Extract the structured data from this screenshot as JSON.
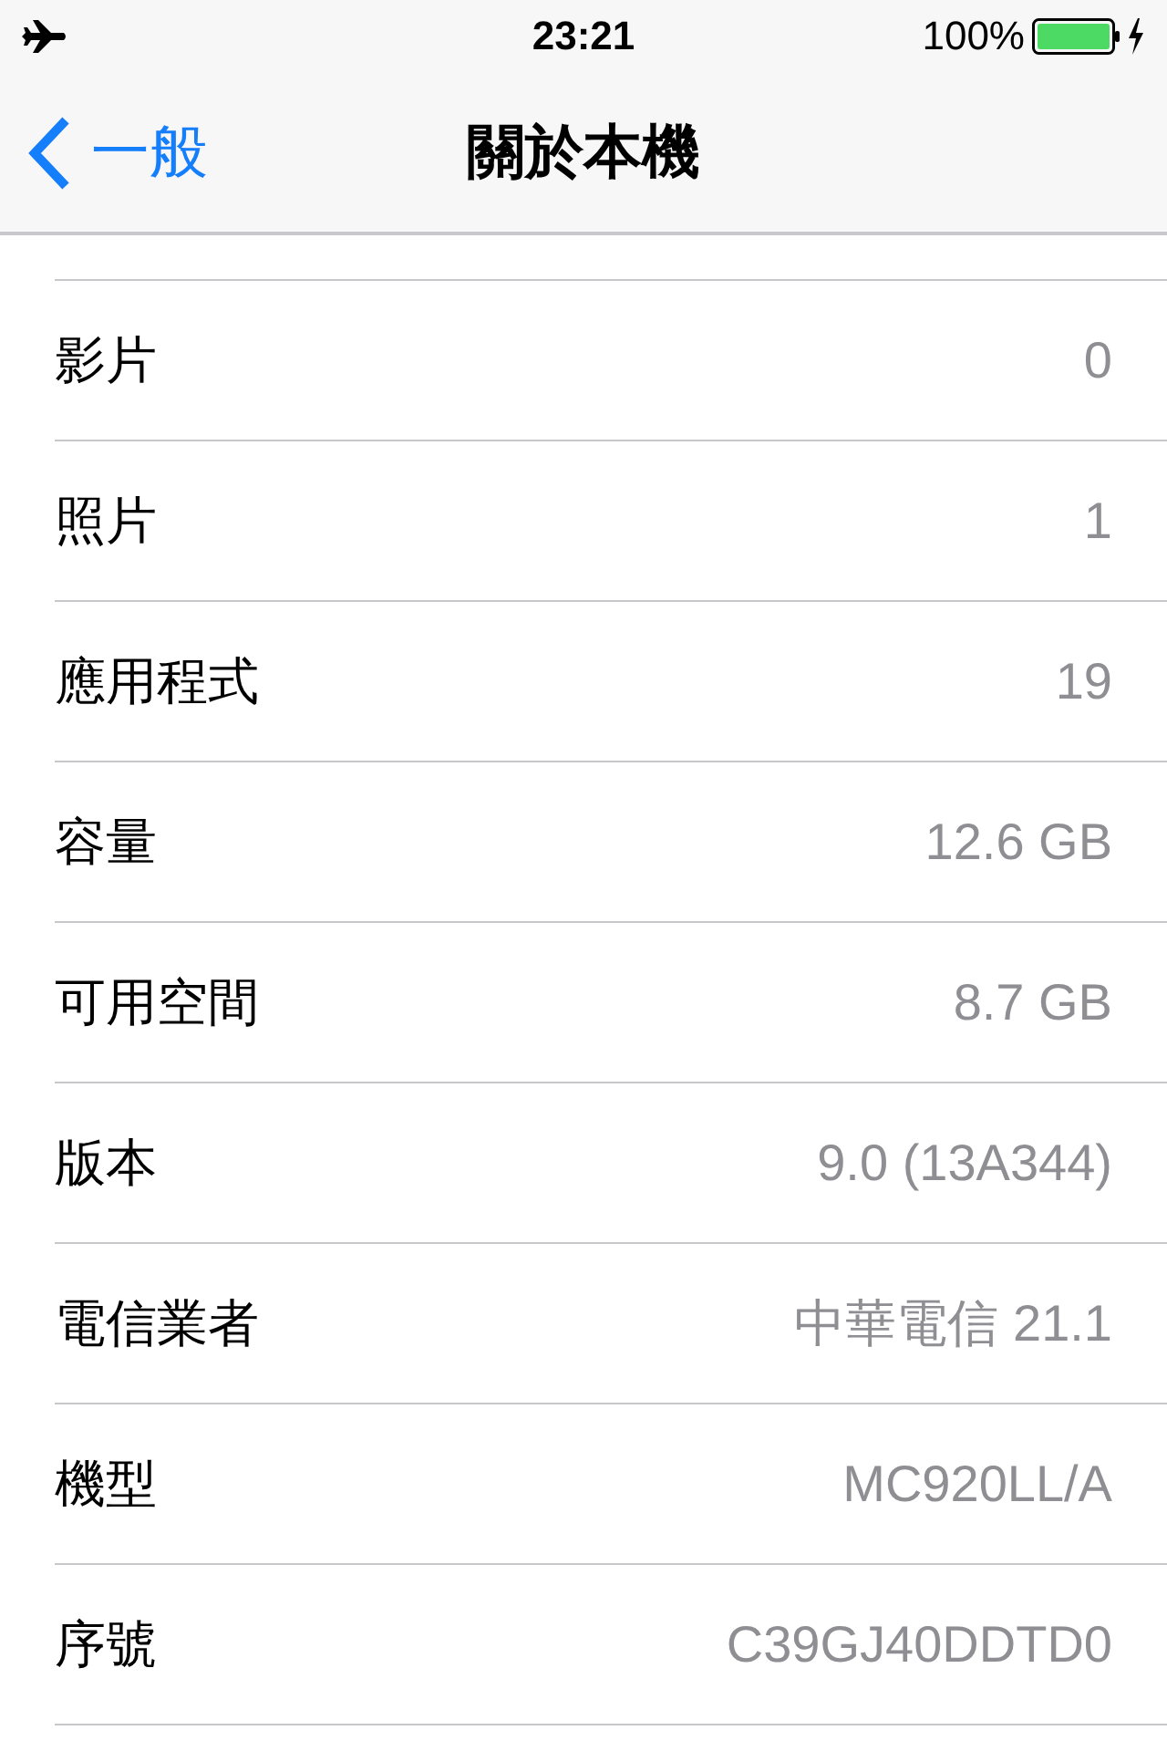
{
  "status_bar": {
    "time": "23:21",
    "battery_percent": "100%"
  },
  "nav": {
    "back_label": "一般",
    "title": "關於本機"
  },
  "rows": [
    {
      "label": "影片",
      "value": "0"
    },
    {
      "label": "照片",
      "value": "1"
    },
    {
      "label": "應用程式",
      "value": "19"
    },
    {
      "label": "容量",
      "value": "12.6 GB"
    },
    {
      "label": "可用空間",
      "value": "8.7 GB"
    },
    {
      "label": "版本",
      "value": "9.0 (13A344)"
    },
    {
      "label": "電信業者",
      "value": "中華電信 21.1"
    },
    {
      "label": "機型",
      "value": "MC920LL/A"
    },
    {
      "label": "序號",
      "value": "C39GJ40DDTD0"
    }
  ]
}
